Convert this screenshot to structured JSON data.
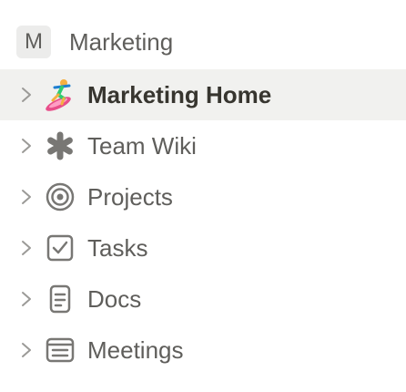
{
  "workspace": {
    "avatar_letter": "M",
    "name": "Marketing"
  },
  "items": [
    {
      "label": "Marketing Home",
      "icon": "surfer-emoji-icon",
      "active": true
    },
    {
      "label": "Team Wiki",
      "icon": "asterisk-icon",
      "active": false
    },
    {
      "label": "Projects",
      "icon": "target-icon",
      "active": false
    },
    {
      "label": "Tasks",
      "icon": "checkbox-icon",
      "active": false
    },
    {
      "label": "Docs",
      "icon": "document-icon",
      "active": false
    },
    {
      "label": "Meetings",
      "icon": "notes-icon",
      "active": false
    }
  ],
  "colors": {
    "text": "#5f5e5b",
    "active_text": "#37352f",
    "active_bg": "#f1f1ef",
    "icon": "#787774"
  }
}
